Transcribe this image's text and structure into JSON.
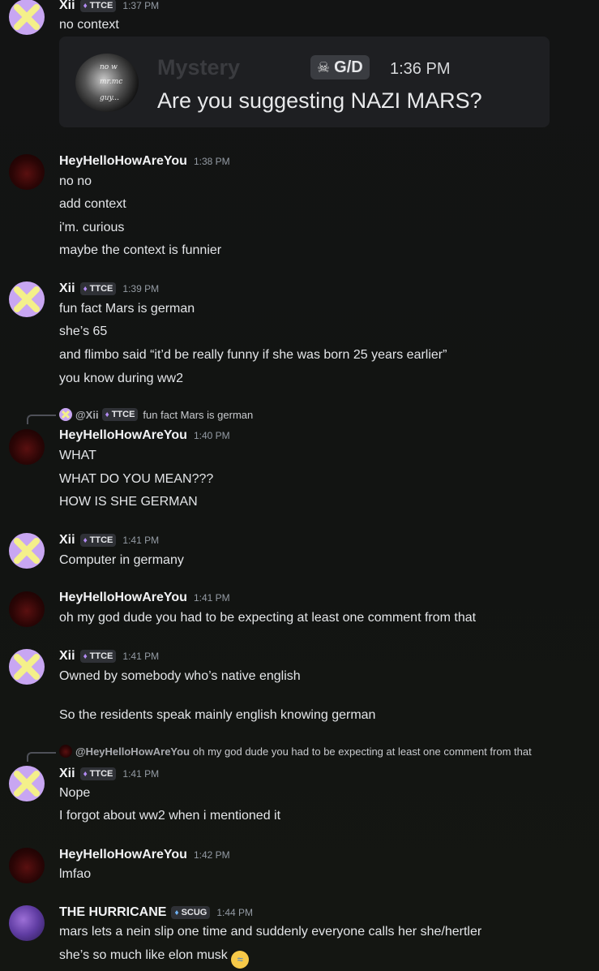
{
  "messages": [
    {
      "user": "Xii",
      "tag": "TTCE",
      "time": "1:37 PM",
      "lines": [
        "no context"
      ],
      "embed": {
        "user": "Mystery",
        "tag": "G/D",
        "time": "1:36 PM",
        "text": "Are you suggesting NAZI MARS?",
        "avatar_text": [
          "no w",
          "mr.mc",
          "guy..."
        ]
      }
    },
    {
      "user": "HeyHelloHowAreYou",
      "time": "1:38 PM",
      "lines": [
        "no no",
        "add context",
        "i'm. curious",
        "maybe the context is funnier"
      ]
    },
    {
      "user": "Xii",
      "tag": "TTCE",
      "time": "1:39 PM",
      "lines": [
        "fun fact Mars is german",
        "she’s 65",
        "and flimbo said “it’d be really funny if she was born 25 years earlier”",
        "you know during ww2"
      ]
    },
    {
      "reply": {
        "user": "@Xii",
        "tag": "TTCE",
        "text": "fun fact Mars is german"
      },
      "user": "HeyHelloHowAreYou",
      "time": "1:40 PM",
      "lines": [
        "WHAT",
        "WHAT DO YOU MEAN???",
        "HOW IS SHE GERMAN"
      ]
    },
    {
      "user": "Xii",
      "tag": "TTCE",
      "time": "1:41 PM",
      "lines": [
        "Computer in germany"
      ]
    },
    {
      "user": "HeyHelloHowAreYou",
      "time": "1:41 PM",
      "lines": [
        "oh my god dude you had to be expecting at least one comment from that"
      ]
    },
    {
      "user": "Xii",
      "tag": "TTCE",
      "time": "1:41 PM",
      "lines": [
        "Owned by somebody who’s native english",
        "So the residents speak mainly english knowing german"
      ]
    },
    {
      "reply": {
        "user": "@HeyHelloHowAreYou",
        "text": "oh my god dude you had to be expecting at least one comment from that"
      },
      "user": "Xii",
      "tag": "TTCE",
      "time": "1:41 PM",
      "lines": [
        "Nope",
        "I forgot about ww2 when i mentioned it"
      ]
    },
    {
      "user": "HeyHelloHowAreYou",
      "time": "1:42 PM",
      "lines": [
        "lmfao"
      ]
    },
    {
      "user": "THE HURRICANE",
      "tag": "SCUG",
      "time": "1:44 PM",
      "lines": [
        "mars lets a nein slip one time and suddenly everyone calls her she/hertler",
        "she’s so much like elon musk"
      ],
      "emoji": "loudly-crying-face"
    }
  ],
  "colors": {
    "background": "#131414",
    "username": "#f2f3f5",
    "timestamp": "#949ba4",
    "tag_bg": "#2f3136",
    "embed_bg": "#1e1f22",
    "xii_avatar": "#c8a6f2",
    "xii_cross": "#f4f08a"
  }
}
